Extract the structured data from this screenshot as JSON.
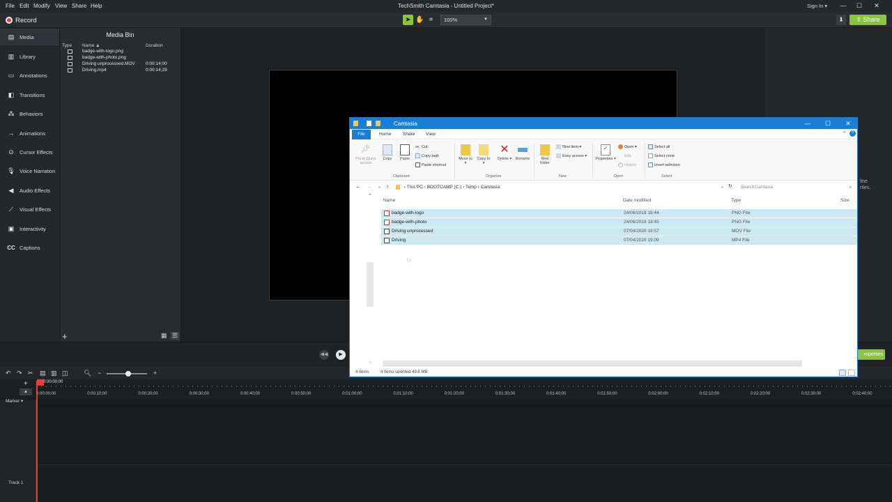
{
  "app": {
    "title": "TechSmith Camtasia - Untitled Project*",
    "menu": [
      "File",
      "Edit",
      "Modify",
      "View",
      "Share",
      "Help"
    ],
    "sign_in": "Sign In ▾",
    "record_label": "Record",
    "zoom": "100%",
    "share_label": "Share",
    "accent_color": "#8bc53f",
    "record_color": "#e0413b"
  },
  "tools": [
    {
      "label": "Media",
      "icon": "film-strip-icon"
    },
    {
      "label": "Library",
      "icon": "books-icon"
    },
    {
      "label": "Annotations",
      "icon": "annotation-icon"
    },
    {
      "label": "Transitions",
      "icon": "transition-icon"
    },
    {
      "label": "Behaviors",
      "icon": "behaviors-icon"
    },
    {
      "label": "Animations",
      "icon": "animation-arrow-icon"
    },
    {
      "label": "Cursor Effects",
      "icon": "cursor-effects-icon"
    },
    {
      "label": "Voice Narration",
      "icon": "microphone-icon"
    },
    {
      "label": "Audio Effects",
      "icon": "speaker-icon"
    },
    {
      "label": "Visual Effects",
      "icon": "wand-icon"
    },
    {
      "label": "Interactivity",
      "icon": "interactivity-icon"
    },
    {
      "label": "Captions",
      "icon": "cc-icon"
    }
  ],
  "media_bin": {
    "title": "Media Bin",
    "columns": [
      "Type",
      "Name ▲",
      "Duration"
    ],
    "items": [
      {
        "name": "badge-with-logo.png",
        "duration": ""
      },
      {
        "name": "badge-with-photo.png",
        "duration": ""
      },
      {
        "name": "Driving unprocessed.MOV",
        "duration": "0:00:14;00"
      },
      {
        "name": "Driving.mp4",
        "duration": "0:00:14;29"
      }
    ]
  },
  "properties": {
    "text_lines": [
      "line",
      "rties."
    ],
    "button_label": "roperties"
  },
  "timeline": {
    "playhead_time": "0:00:00;00",
    "marker_label": "Marker ▾",
    "track_label": "Track 1",
    "ticks": [
      "0:00:00;00",
      "0:00:10;00",
      "0:00:20;00",
      "0:00:30;00",
      "0:00:40;00",
      "0:00:50;00",
      "0:01:00;00",
      "0:01:10;00",
      "0:01:20;00",
      "0:01:30;00",
      "0:01:40;00",
      "0:01:50;00",
      "0:02:00;00",
      "0:02:10;00",
      "0:02:20;00",
      "0:02:30;00",
      "0:02:40;00"
    ]
  },
  "explorer": {
    "title": "Camtasia",
    "tabs": [
      "File",
      "Home",
      "Share",
      "View"
    ],
    "ribbon": {
      "pin": "Pin to Quick access",
      "copy": "Copy",
      "paste": "Paste",
      "cut": "Cut",
      "copy_path": "Copy path",
      "paste_shortcut": "Paste shortcut",
      "move_to": "Move to ▾",
      "copy_to": "Copy to ▾",
      "delete": "Delete ▾",
      "rename": "Rename",
      "new_folder": "New folder",
      "new_item": "New item ▾",
      "easy_access": "Easy access ▾",
      "properties": "Properties ▾",
      "open": "Open ▾",
      "edit": "Edit",
      "history": "History",
      "select_all": "Select all",
      "select_none": "Select none",
      "invert_selection": "Invert selection",
      "groups": [
        "Clipboard",
        "Organize",
        "New",
        "Open",
        "Select"
      ]
    },
    "address": [
      "This PC",
      "BOOTCAMP (C:)",
      "Temp",
      "Camtasia"
    ],
    "search_placeholder": "Search Camtasia",
    "columns": [
      "Name",
      "Date modified",
      "Type",
      "Size"
    ],
    "files": [
      {
        "name": "badge-with-logo",
        "date": "24/06/2019 18:44",
        "type": "PNG File"
      },
      {
        "name": "badge-with-photo",
        "date": "24/06/2019 18:45",
        "type": "PNG File"
      },
      {
        "name": "Driving unprocessed",
        "date": "07/04/2020 18:57",
        "type": "MOV File"
      },
      {
        "name": "Driving",
        "date": "07/04/2020 19:09",
        "type": "MP4 File"
      }
    ],
    "status_items": "4 items",
    "status_selected": "4 items selected  49.6 MB",
    "accent_color": "#1a7fd4",
    "selection_color": "#cce8f3"
  }
}
